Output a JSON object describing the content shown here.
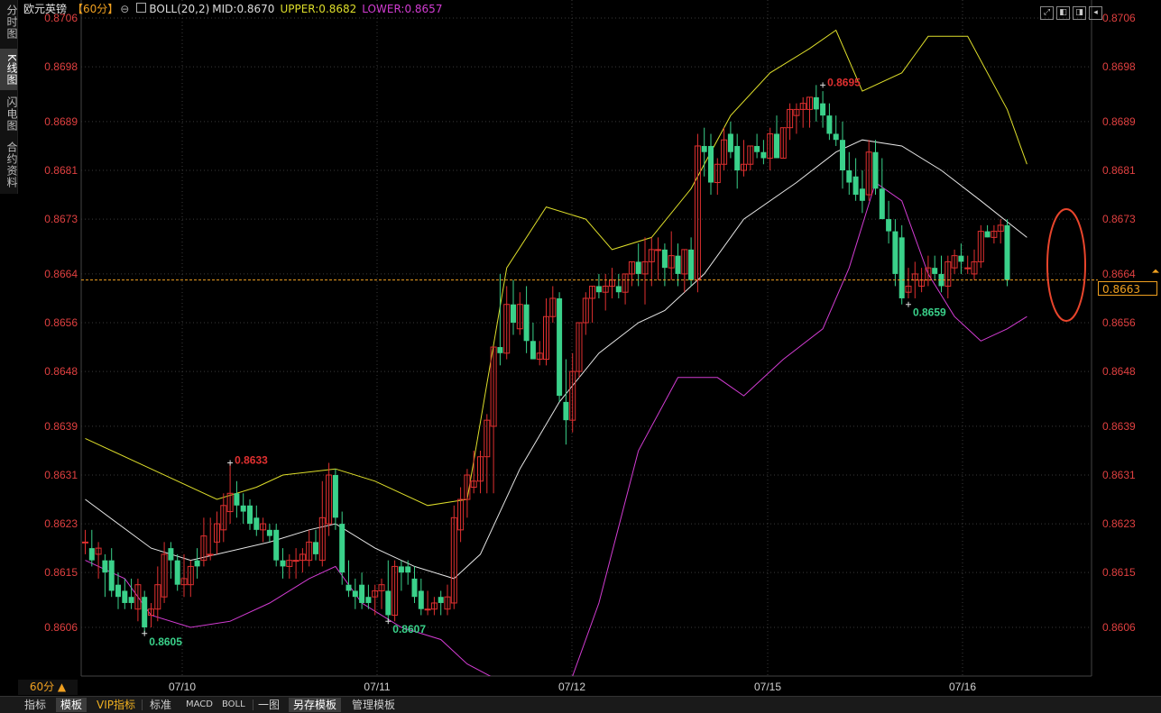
{
  "side_tabs": [
    {
      "label": "分时图",
      "active": false
    },
    {
      "label": "K线图",
      "active": true
    },
    {
      "label": "闪电图",
      "active": false
    },
    {
      "label": "合约资料",
      "active": false
    }
  ],
  "header": {
    "symbol": "欧元英镑",
    "period": "【60分】",
    "indicator": "BOLL(20,2)",
    "mid": "MID:0.8670",
    "upper": "UPPER:0.8682",
    "lower": "LOWER:0.8657"
  },
  "top_icons": [
    "fullscreen-icon",
    "split-left-icon",
    "split-right-icon",
    "back-icon"
  ],
  "period_button": "60分 ▲",
  "bottom_bar": [
    {
      "label": "指标",
      "style": "normal"
    },
    {
      "label": "模板",
      "style": "active"
    },
    {
      "label": "VIP指标",
      "style": "vip"
    },
    {
      "label": "标准",
      "style": "normal"
    },
    {
      "label": "MACD",
      "style": "normal"
    },
    {
      "label": "BOLL",
      "style": "normal"
    },
    {
      "label": "一图",
      "style": "normal"
    },
    {
      "label": "另存模板",
      "style": "active"
    },
    {
      "label": "管理模板",
      "style": "normal"
    }
  ],
  "colors": {
    "up": "#e03030",
    "down": "#3ad18a",
    "mid": "#e6e6e6",
    "upper": "#dede2a",
    "lower": "#d23cd2",
    "axis_text": "#e04040",
    "grid": "#3a3a3a",
    "current_line": "#f0a020",
    "highlight": "#e8452c"
  },
  "chart_data": {
    "type": "candlestick",
    "y_ticks": [
      "0.8706",
      "0.8698",
      "0.8689",
      "0.8681",
      "0.8673",
      "0.8664",
      "0.8656",
      "0.8648",
      "0.8639",
      "0.8631",
      "0.8623",
      "0.8615",
      "0.8606"
    ],
    "ylim": [
      0.8599,
      0.8709
    ],
    "x_labels": [
      "07/10",
      "07/11",
      "07/12",
      "07/15",
      "07/16"
    ],
    "current_price": "0.8663",
    "annotations": [
      {
        "text": "0.8633",
        "bar": 22,
        "price": 0.8633,
        "kind": "high"
      },
      {
        "text": "0.8605",
        "bar": 9,
        "price": 0.8605,
        "kind": "low"
      },
      {
        "text": "0.8607",
        "bar": 46,
        "price": 0.8607,
        "kind": "low"
      },
      {
        "text": "0.8695",
        "bar": 112,
        "price": 0.8695,
        "kind": "high"
      },
      {
        "text": "0.8659",
        "bar": 125,
        "price": 0.8659,
        "kind": "low"
      }
    ],
    "candles": [
      [
        0.862,
        0.8622,
        0.8618,
        0.862
      ],
      [
        0.8619,
        0.8622,
        0.8616,
        0.8617
      ],
      [
        0.8618,
        0.862,
        0.8614,
        0.8619
      ],
      [
        0.8617,
        0.8618,
        0.8611,
        0.8615
      ],
      [
        0.8617,
        0.8619,
        0.8611,
        0.8612
      ],
      [
        0.8613,
        0.8615,
        0.8609,
        0.8611
      ],
      [
        0.8612,
        0.8614,
        0.8609,
        0.861
      ],
      [
        0.8611,
        0.8614,
        0.8609,
        0.861
      ],
      [
        0.8609,
        0.8614,
        0.8607,
        0.8613
      ],
      [
        0.8611,
        0.8612,
        0.8605,
        0.8606
      ],
      [
        0.8608,
        0.861,
        0.8606,
        0.8609
      ],
      [
        0.8609,
        0.8616,
        0.8607,
        0.8613
      ],
      [
        0.8611,
        0.862,
        0.861,
        0.8618
      ],
      [
        0.8619,
        0.862,
        0.8614,
        0.8617
      ],
      [
        0.8617,
        0.8618,
        0.8612,
        0.8613
      ],
      [
        0.8613,
        0.8618,
        0.8611,
        0.8614
      ],
      [
        0.8613,
        0.8617,
        0.8611,
        0.8616
      ],
      [
        0.8617,
        0.8619,
        0.8614,
        0.8616
      ],
      [
        0.8617,
        0.8624,
        0.8616,
        0.8621
      ],
      [
        0.8618,
        0.8624,
        0.8617,
        0.8618
      ],
      [
        0.862,
        0.8625,
        0.8618,
        0.8623
      ],
      [
        0.8622,
        0.8628,
        0.862,
        0.8626
      ],
      [
        0.8625,
        0.8633,
        0.8623,
        0.8628
      ],
      [
        0.8628,
        0.863,
        0.8624,
        0.8626
      ],
      [
        0.8626,
        0.8628,
        0.8623,
        0.8625
      ],
      [
        0.8626,
        0.8627,
        0.8622,
        0.8623
      ],
      [
        0.8624,
        0.8626,
        0.8621,
        0.8622
      ],
      [
        0.8622,
        0.8624,
        0.862,
        0.8623
      ],
      [
        0.8622,
        0.8623,
        0.862,
        0.8621
      ],
      [
        0.8622,
        0.8623,
        0.8616,
        0.8617
      ],
      [
        0.8617,
        0.8619,
        0.8614,
        0.8616
      ],
      [
        0.8616,
        0.8618,
        0.8614,
        0.8617
      ],
      [
        0.8617,
        0.8619,
        0.8614,
        0.8617
      ],
      [
        0.8617,
        0.8619,
        0.8615,
        0.8618
      ],
      [
        0.8617,
        0.8622,
        0.8616,
        0.862
      ],
      [
        0.862,
        0.8622,
        0.8617,
        0.8618
      ],
      [
        0.8617,
        0.863,
        0.8616,
        0.8624
      ],
      [
        0.8623,
        0.8633,
        0.8621,
        0.8631
      ],
      [
        0.8631,
        0.8632,
        0.8622,
        0.8624
      ],
      [
        0.8623,
        0.8625,
        0.8613,
        0.8615
      ],
      [
        0.8613,
        0.8617,
        0.8611,
        0.8612
      ],
      [
        0.8612,
        0.8614,
        0.8609,
        0.8611
      ],
      [
        0.8613,
        0.8615,
        0.8609,
        0.861
      ],
      [
        0.8611,
        0.8613,
        0.8609,
        0.861
      ],
      [
        0.8611,
        0.8613,
        0.8608,
        0.8612
      ],
      [
        0.8612,
        0.8614,
        0.8609,
        0.8613
      ],
      [
        0.8612,
        0.8617,
        0.8607,
        0.8608
      ],
      [
        0.8608,
        0.8617,
        0.8607,
        0.8616
      ],
      [
        0.8616,
        0.8617,
        0.8612,
        0.8615
      ],
      [
        0.8616,
        0.8617,
        0.8613,
        0.8615
      ],
      [
        0.8614,
        0.8616,
        0.861,
        0.8611
      ],
      [
        0.8612,
        0.8614,
        0.8608,
        0.8609
      ],
      [
        0.8609,
        0.8612,
        0.8608,
        0.8609
      ],
      [
        0.8609,
        0.8611,
        0.8608,
        0.861
      ],
      [
        0.8611,
        0.8612,
        0.8608,
        0.861
      ],
      [
        0.8609,
        0.8613,
        0.8608,
        0.8611
      ],
      [
        0.861,
        0.8626,
        0.8609,
        0.8624
      ],
      [
        0.8622,
        0.8629,
        0.862,
        0.8627
      ],
      [
        0.8627,
        0.8632,
        0.8624,
        0.8631
      ],
      [
        0.8629,
        0.8635,
        0.8628,
        0.863
      ],
      [
        0.863,
        0.8635,
        0.8628,
        0.8634
      ],
      [
        0.8634,
        0.8641,
        0.8628,
        0.864
      ],
      [
        0.8639,
        0.8652,
        0.8628,
        0.8652
      ],
      [
        0.8652,
        0.8664,
        0.8649,
        0.8651
      ],
      [
        0.8651,
        0.8662,
        0.865,
        0.8659
      ],
      [
        0.8659,
        0.8663,
        0.8654,
        0.8656
      ],
      [
        0.8655,
        0.8661,
        0.8654,
        0.8659
      ],
      [
        0.8659,
        0.8662,
        0.8651,
        0.8653
      ],
      [
        0.8653,
        0.8656,
        0.865,
        0.865
      ],
      [
        0.865,
        0.8653,
        0.8649,
        0.8651
      ],
      [
        0.865,
        0.866,
        0.8649,
        0.8657
      ],
      [
        0.8657,
        0.8662,
        0.8656,
        0.866
      ],
      [
        0.866,
        0.8661,
        0.8643,
        0.8644
      ],
      [
        0.8643,
        0.865,
        0.8636,
        0.864
      ],
      [
        0.864,
        0.8651,
        0.8638,
        0.8648
      ],
      [
        0.8648,
        0.8656,
        0.8647,
        0.8656
      ],
      [
        0.8656,
        0.8661,
        0.8654,
        0.866
      ],
      [
        0.866,
        0.8662,
        0.8656,
        0.8662
      ],
      [
        0.8662,
        0.8664,
        0.866,
        0.8661
      ],
      [
        0.8661,
        0.8664,
        0.8658,
        0.8662
      ],
      [
        0.8662,
        0.8665,
        0.866,
        0.8663
      ],
      [
        0.8662,
        0.8664,
        0.866,
        0.8661
      ],
      [
        0.8661,
        0.8664,
        0.8659,
        0.8664
      ],
      [
        0.8664,
        0.8666,
        0.8662,
        0.8666
      ],
      [
        0.8666,
        0.8669,
        0.8662,
        0.8664
      ],
      [
        0.8664,
        0.867,
        0.8659,
        0.8666
      ],
      [
        0.8666,
        0.867,
        0.8662,
        0.8668
      ],
      [
        0.8668,
        0.867,
        0.8663,
        0.8668
      ],
      [
        0.8668,
        0.8669,
        0.8662,
        0.8665
      ],
      [
        0.8665,
        0.8671,
        0.8663,
        0.8667
      ],
      [
        0.8667,
        0.8669,
        0.8662,
        0.8664
      ],
      [
        0.8664,
        0.8668,
        0.8661,
        0.8668
      ],
      [
        0.8668,
        0.867,
        0.8662,
        0.8663
      ],
      [
        0.8663,
        0.8687,
        0.8661,
        0.8685
      ],
      [
        0.8685,
        0.8688,
        0.868,
        0.8684
      ],
      [
        0.8685,
        0.8687,
        0.8677,
        0.8679
      ],
      [
        0.8679,
        0.8683,
        0.8677,
        0.8682
      ],
      [
        0.8682,
        0.8688,
        0.8681,
        0.8686
      ],
      [
        0.8687,
        0.8689,
        0.8683,
        0.8684
      ],
      [
        0.8685,
        0.8687,
        0.8678,
        0.8681
      ],
      [
        0.8681,
        0.8686,
        0.868,
        0.8682
      ],
      [
        0.8682,
        0.8685,
        0.8681,
        0.8685
      ],
      [
        0.8685,
        0.8687,
        0.8683,
        0.8684
      ],
      [
        0.8684,
        0.8686,
        0.8682,
        0.8683
      ],
      [
        0.8683,
        0.8688,
        0.8681,
        0.8687
      ],
      [
        0.8687,
        0.869,
        0.8683,
        0.8683
      ],
      [
        0.8683,
        0.8688,
        0.8683,
        0.8688
      ],
      [
        0.8688,
        0.8692,
        0.8686,
        0.8691
      ],
      [
        0.869,
        0.8692,
        0.8687,
        0.8691
      ],
      [
        0.8691,
        0.8693,
        0.8688,
        0.8692
      ],
      [
        0.8691,
        0.8693,
        0.8688,
        0.8693
      ],
      [
        0.8693,
        0.8695,
        0.8689,
        0.8691
      ],
      [
        0.8692,
        0.8694,
        0.8688,
        0.869
      ],
      [
        0.869,
        0.8692,
        0.8686,
        0.8687
      ],
      [
        0.8687,
        0.869,
        0.8685,
        0.8686
      ],
      [
        0.8686,
        0.8689,
        0.8678,
        0.8681
      ],
      [
        0.8681,
        0.8684,
        0.8677,
        0.8679
      ],
      [
        0.868,
        0.8683,
        0.8676,
        0.8677
      ],
      [
        0.8678,
        0.8681,
        0.8674,
        0.8676
      ],
      [
        0.8677,
        0.8686,
        0.8676,
        0.8684
      ],
      [
        0.8684,
        0.8686,
        0.8677,
        0.8678
      ],
      [
        0.8678,
        0.8683,
        0.8673,
        0.8673
      ],
      [
        0.8673,
        0.8676,
        0.8669,
        0.8671
      ],
      [
        0.8671,
        0.8673,
        0.8662,
        0.8664
      ],
      [
        0.867,
        0.8672,
        0.8659,
        0.866
      ],
      [
        0.8661,
        0.8665,
        0.866,
        0.8662
      ],
      [
        0.8663,
        0.8666,
        0.866,
        0.8664
      ],
      [
        0.8662,
        0.8665,
        0.8661,
        0.8663
      ],
      [
        0.8663,
        0.8667,
        0.8662,
        0.8665
      ],
      [
        0.8665,
        0.8667,
        0.8663,
        0.8664
      ],
      [
        0.8664,
        0.8667,
        0.8661,
        0.8662
      ],
      [
        0.8662,
        0.8667,
        0.866,
        0.8666
      ],
      [
        0.8665,
        0.8668,
        0.8664,
        0.8667
      ],
      [
        0.8667,
        0.8669,
        0.8664,
        0.8666
      ],
      [
        0.8665,
        0.8667,
        0.8664,
        0.8665
      ],
      [
        0.8664,
        0.8668,
        0.8663,
        0.8666
      ],
      [
        0.8666,
        0.8672,
        0.8665,
        0.8671
      ],
      [
        0.8671,
        0.8672,
        0.867,
        0.867
      ],
      [
        0.867,
        0.8672,
        0.8669,
        0.8671
      ],
      [
        0.8671,
        0.8673,
        0.8669,
        0.8672
      ],
      [
        0.8672,
        0.8673,
        0.8662,
        0.8663
      ]
    ],
    "boll_upper": [
      [
        0,
        0.8637
      ],
      [
        10,
        0.8632
      ],
      [
        20,
        0.8627
      ],
      [
        26,
        0.8629
      ],
      [
        30,
        0.8631
      ],
      [
        38,
        0.8632
      ],
      [
        44,
        0.863
      ],
      [
        52,
        0.8626
      ],
      [
        58,
        0.8627
      ],
      [
        64,
        0.8665
      ],
      [
        70,
        0.8675
      ],
      [
        76,
        0.8673
      ],
      [
        80,
        0.8668
      ],
      [
        86,
        0.867
      ],
      [
        92,
        0.8678
      ],
      [
        98,
        0.869
      ],
      [
        104,
        0.8697
      ],
      [
        110,
        0.8701
      ],
      [
        114,
        0.8704
      ],
      [
        118,
        0.8694
      ],
      [
        124,
        0.8697
      ],
      [
        128,
        0.8703
      ],
      [
        134,
        0.8703
      ],
      [
        140,
        0.8691
      ],
      [
        143,
        0.8682
      ]
    ],
    "boll_mid": [
      [
        0,
        0.8627
      ],
      [
        10,
        0.8619
      ],
      [
        16,
        0.8617
      ],
      [
        20,
        0.8618
      ],
      [
        28,
        0.862
      ],
      [
        34,
        0.8622
      ],
      [
        38,
        0.8623
      ],
      [
        44,
        0.8619
      ],
      [
        50,
        0.8616
      ],
      [
        56,
        0.8614
      ],
      [
        60,
        0.8618
      ],
      [
        66,
        0.8632
      ],
      [
        72,
        0.8643
      ],
      [
        78,
        0.8651
      ],
      [
        84,
        0.8656
      ],
      [
        88,
        0.8658
      ],
      [
        94,
        0.8664
      ],
      [
        100,
        0.8673
      ],
      [
        108,
        0.8679
      ],
      [
        114,
        0.8684
      ],
      [
        118,
        0.8686
      ],
      [
        124,
        0.8685
      ],
      [
        130,
        0.8681
      ],
      [
        136,
        0.8676
      ],
      [
        143,
        0.867
      ]
    ],
    "boll_lower": [
      [
        0,
        0.8617
      ],
      [
        6,
        0.8614
      ],
      [
        10,
        0.8608
      ],
      [
        16,
        0.8606
      ],
      [
        22,
        0.8607
      ],
      [
        28,
        0.861
      ],
      [
        34,
        0.8614
      ],
      [
        38,
        0.8616
      ],
      [
        42,
        0.861
      ],
      [
        48,
        0.8606
      ],
      [
        54,
        0.8604
      ],
      [
        58,
        0.86
      ],
      [
        72,
        0.8592
      ],
      [
        78,
        0.861
      ],
      [
        84,
        0.8635
      ],
      [
        90,
        0.8647
      ],
      [
        96,
        0.8647
      ],
      [
        100,
        0.8644
      ],
      [
        106,
        0.865
      ],
      [
        112,
        0.8655
      ],
      [
        116,
        0.8665
      ],
      [
        120,
        0.8679
      ],
      [
        124,
        0.8676
      ],
      [
        128,
        0.8664
      ],
      [
        132,
        0.8657
      ],
      [
        136,
        0.8653
      ],
      [
        140,
        0.8655
      ],
      [
        143,
        0.8657
      ]
    ]
  }
}
